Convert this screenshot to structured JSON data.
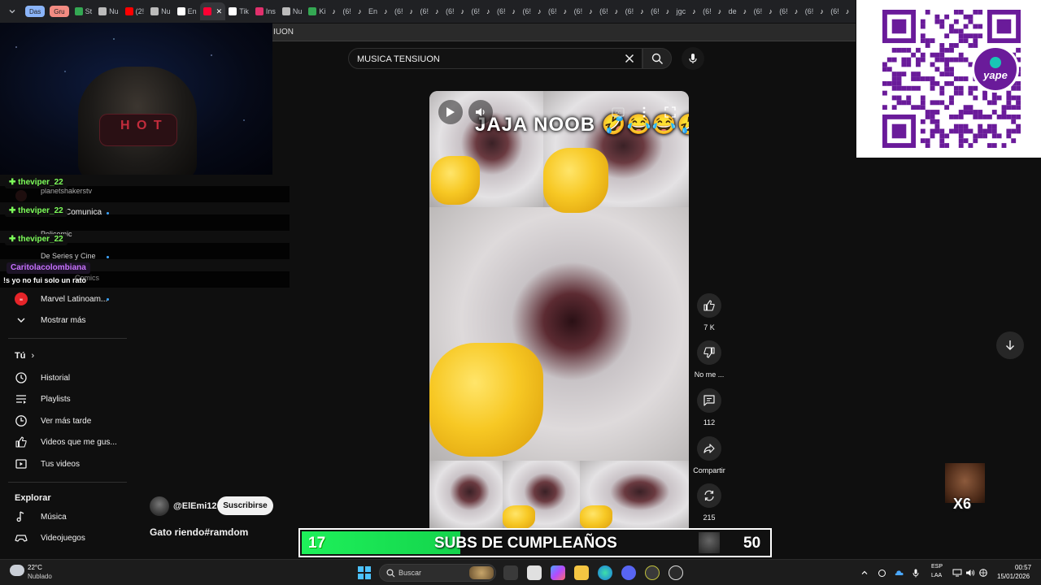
{
  "browser": {
    "tab_groups": [
      {
        "label": "Das",
        "color": "#8ab4f8"
      },
      {
        "label": "Gru",
        "color": "#f28b82"
      }
    ],
    "tabs": [
      {
        "label": "St"
      },
      {
        "label": "Nu"
      },
      {
        "label": "(2!"
      },
      {
        "label": "Nu"
      },
      {
        "label": "En"
      },
      {
        "label": ""
      },
      {
        "label": "Tik"
      },
      {
        "label": "Ins"
      },
      {
        "label": "Nu"
      },
      {
        "label": "Ki"
      },
      {
        "label": "(6!"
      },
      {
        "label": "En"
      },
      {
        "label": "(6!"
      },
      {
        "label": "(6!"
      },
      {
        "label": "(6!"
      },
      {
        "label": "(6!"
      },
      {
        "label": "(6!"
      },
      {
        "label": "(6!"
      },
      {
        "label": "(6!"
      },
      {
        "label": "(6!"
      },
      {
        "label": "(6!"
      },
      {
        "label": "(6!"
      },
      {
        "label": "(6!"
      },
      {
        "label": "jgc"
      },
      {
        "label": "(6!"
      },
      {
        "label": "de"
      },
      {
        "label": "(6!"
      },
      {
        "label": "(6!"
      },
      {
        "label": "(6!"
      },
      {
        "label": "(6!"
      },
      {
        "label": "mi"
      },
      {
        "label": "(6!"
      }
    ],
    "address_fragment": "IUON"
  },
  "search": {
    "value": "MUSICA TENSIUON",
    "placeholder": "Buscar"
  },
  "chat": [
    {
      "user": "✚ theviper_22",
      "bg_text": "planetshakerstv"
    },
    {
      "user": "✚ theviper_22",
      "bg_text": "Comunica"
    },
    {
      "user": "✚ theviper_22",
      "bg_text": "Policomic"
    },
    {
      "user": "Caritolacolombiana",
      "bg_text": "De Series y Cine"
    },
    {
      "message": "!s yo no fui solo un rato",
      "bg_text": "Comics"
    }
  ],
  "sidebar": {
    "subscriptions": [
      {
        "label": "Marvel Latinoam...",
        "icon": "marvel-avatar",
        "new": true
      },
      {
        "label": "Mostrar más",
        "icon": "chevron-down-icon",
        "new": false
      }
    ],
    "you_heading": "Tú",
    "you_items": [
      {
        "label": "Historial",
        "icon": "history-icon"
      },
      {
        "label": "Playlists",
        "icon": "playlists-icon"
      },
      {
        "label": "Ver más tarde",
        "icon": "watch-later-icon"
      },
      {
        "label": "Videos que me gus...",
        "icon": "liked-videos-icon"
      },
      {
        "label": "Tus videos",
        "icon": "your-videos-icon"
      }
    ],
    "explore_heading": "Explorar",
    "explore_items": [
      {
        "label": "Música",
        "icon": "music-icon"
      },
      {
        "label": "Videojuegos",
        "icon": "gaming-icon"
      }
    ]
  },
  "video": {
    "caption": "JAJA NOOB 🤣😂😂🤣",
    "channel": "@ElEmi12",
    "subscribe_label": "Suscribirse",
    "title": "Gato riendo#ramdom"
  },
  "actions": {
    "like_count": "7 K",
    "dislike_label": "No me ...",
    "comments_count": "112",
    "share_label": "Compartir",
    "remix_count": "215"
  },
  "subathon": {
    "current": "17",
    "label": "SUBS DE CUMPLEAÑOS",
    "goal": "50",
    "progress_fraction": 0.34
  },
  "qr": {
    "brand": "yape",
    "brand_color": "#6a1b9a"
  },
  "emote": {
    "multiplier": "X6"
  },
  "taskbar": {
    "weather_temp": "22°C",
    "weather_desc": "Nublado",
    "search_label": "Buscar",
    "lang_line1": "ESP",
    "lang_line2": "LAA",
    "time": "00:57",
    "date": "15/01/2026"
  }
}
